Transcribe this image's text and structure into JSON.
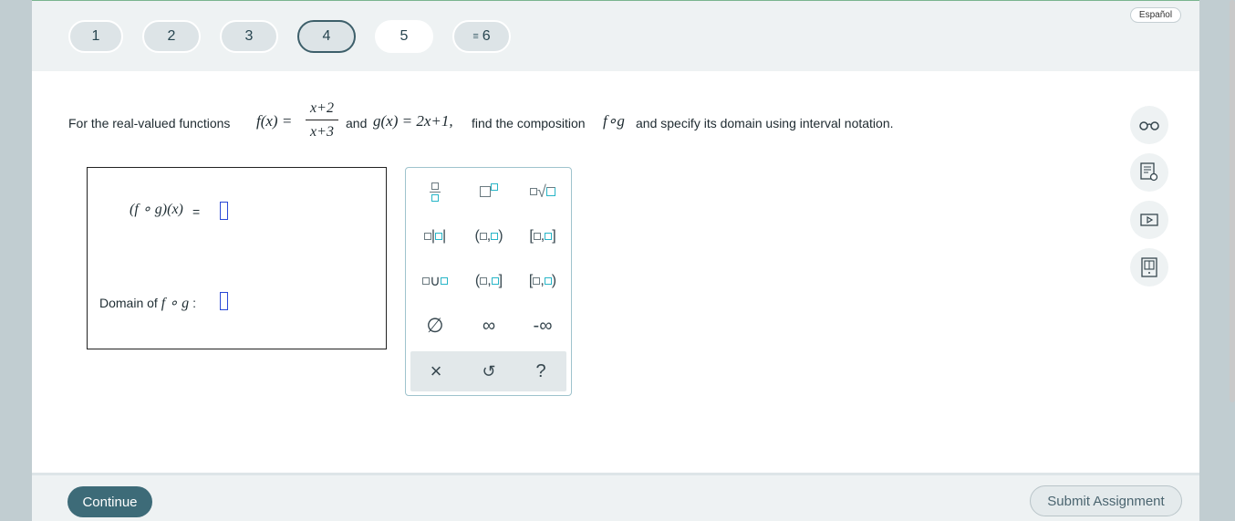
{
  "nav": {
    "questions": [
      {
        "label": "1"
      },
      {
        "label": "2"
      },
      {
        "label": "3"
      },
      {
        "label": "4"
      },
      {
        "label": "5"
      },
      {
        "label": "6"
      }
    ],
    "language_label": "Español"
  },
  "question": {
    "intro": "For the real-valued functions",
    "f_def": "f(x) =",
    "f_num": "x+2",
    "f_den": "x+3",
    "and": "and",
    "g_def": "g(x) = 2x+1,",
    "find": "find the composition",
    "fog": "f∘g",
    "tail": "and specify its domain using interval notation."
  },
  "answer": {
    "composition_label": "(f ∘ g)(x)",
    "equals": "=",
    "domain_label": "Domain of",
    "domain_fog": "f ∘ g",
    "domain_colon": ":"
  },
  "keypad": {
    "keys": {
      "union_sep": "∪",
      "comma": ",",
      "open_paren": "(",
      "close_paren": ")",
      "open_bracket": "[",
      "close_bracket": "]",
      "abs_bar": "|",
      "empty_set": "∅",
      "infinity": "∞",
      "neg_infinity": "-∞",
      "clear": "×",
      "undo": "↺",
      "help": "?"
    }
  },
  "footer": {
    "continue_label": "Continue",
    "submit_label": "Submit Assignment"
  },
  "colors": {
    "accent": "#3d6b78",
    "input_border": "#2a48d6",
    "keypad_box": "#27b5c7"
  }
}
